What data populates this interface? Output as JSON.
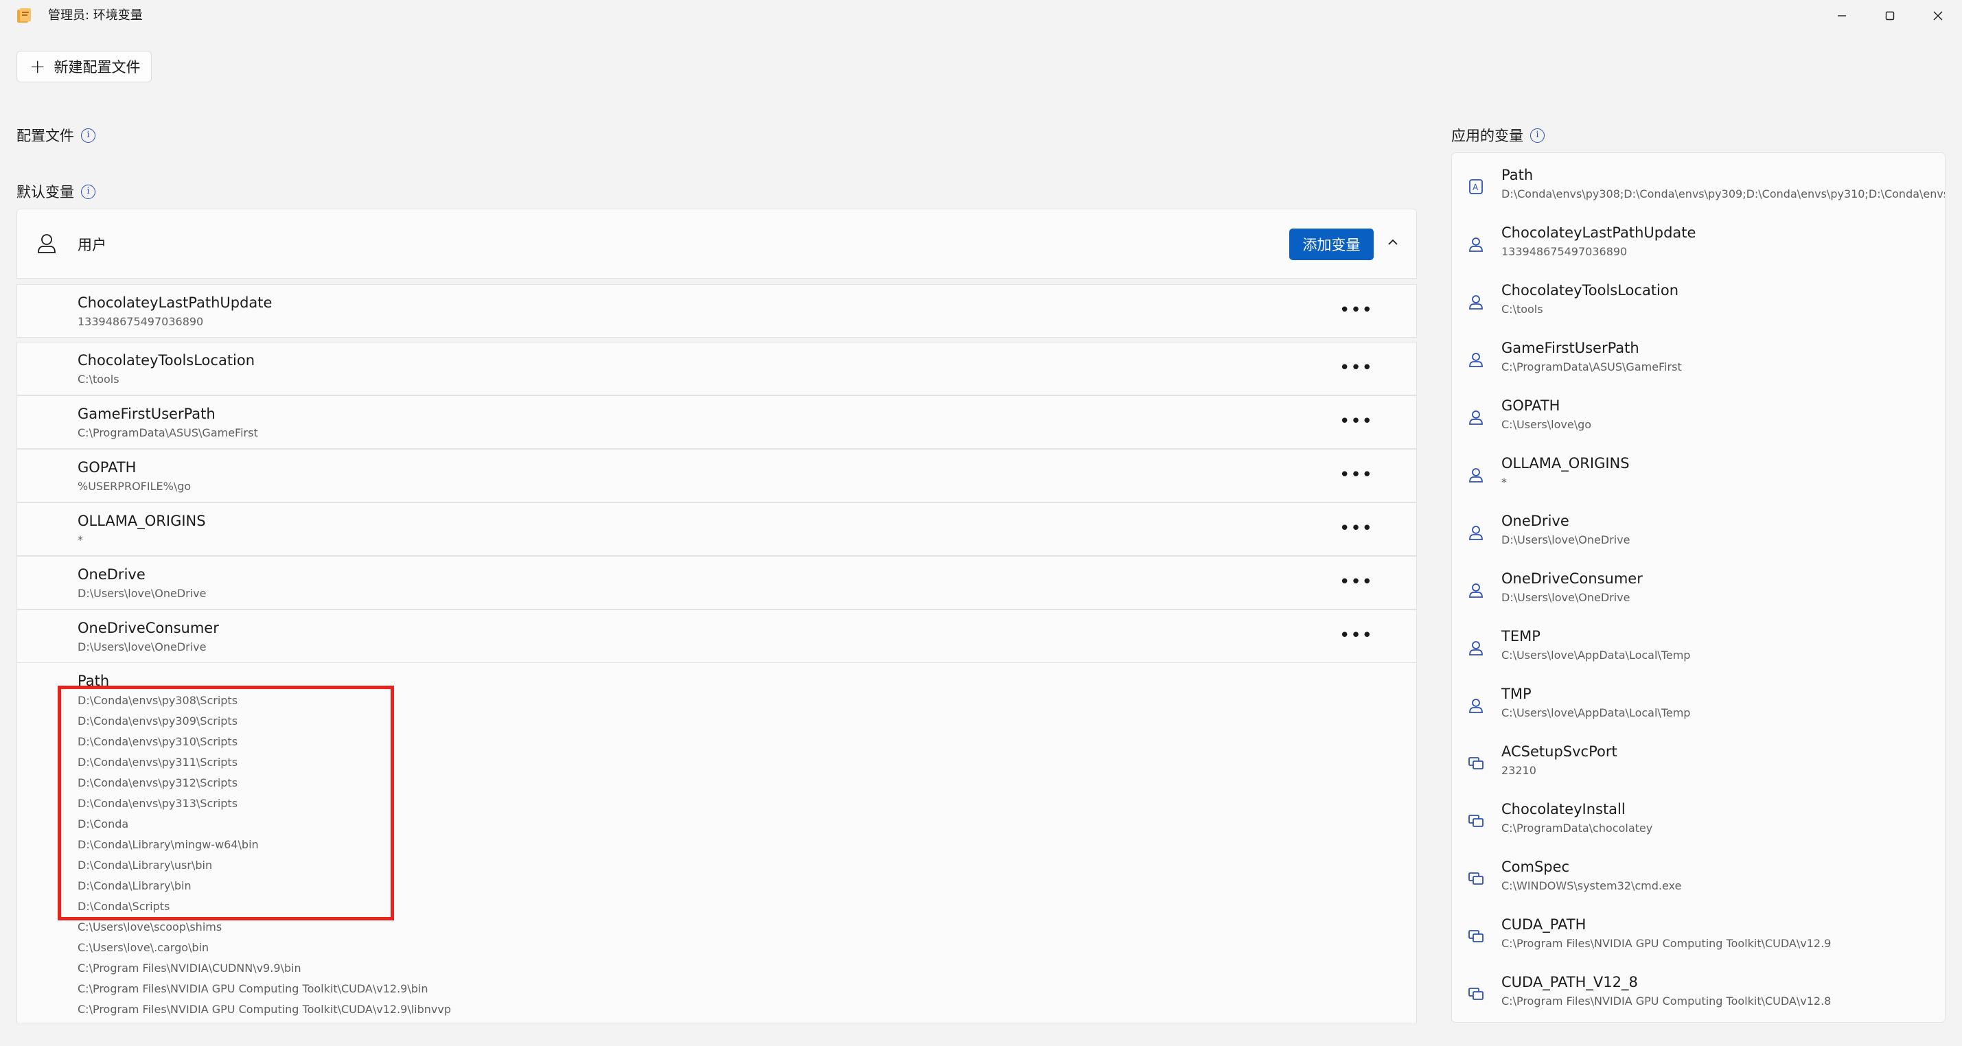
{
  "window": {
    "title": "管理员: 环境变量"
  },
  "toolbar": {
    "new_profile_label": "新建配置文件"
  },
  "sections": {
    "profiles_label": "配置文件",
    "default_vars_label": "默认变量",
    "applied_label": "应用的变量"
  },
  "user_group": {
    "label": "用户",
    "add_button_label": "添加变量"
  },
  "user_variables": [
    {
      "name": "ChocolateyLastPathUpdate",
      "value": "133948675497036890"
    },
    {
      "name": "ChocolateyToolsLocation",
      "value": "C:\\tools"
    },
    {
      "name": "GameFirstUserPath",
      "value": "C:\\ProgramData\\ASUS\\GameFirst"
    },
    {
      "name": "GOPATH",
      "value": "%USERPROFILE%\\go"
    },
    {
      "name": "OLLAMA_ORIGINS",
      "value": "*"
    },
    {
      "name": "OneDrive",
      "value": "D:\\Users\\love\\OneDrive"
    },
    {
      "name": "OneDriveConsumer",
      "value": "D:\\Users\\love\\OneDrive"
    }
  ],
  "path_variable": {
    "name": "Path",
    "values": [
      "D:\\Conda\\envs\\py308\\Scripts",
      "D:\\Conda\\envs\\py309\\Scripts",
      "D:\\Conda\\envs\\py310\\Scripts",
      "D:\\Conda\\envs\\py311\\Scripts",
      "D:\\Conda\\envs\\py312\\Scripts",
      "D:\\Conda\\envs\\py313\\Scripts",
      "D:\\Conda",
      "D:\\Conda\\Library\\mingw-w64\\bin",
      "D:\\Conda\\Library\\usr\\bin",
      "D:\\Conda\\Library\\bin",
      "D:\\Conda\\Scripts",
      "C:\\Users\\love\\scoop\\shims",
      "C:\\Users\\love\\.cargo\\bin",
      "C:\\Program Files\\NVIDIA\\CUDNN\\v9.9\\bin",
      "C:\\Program Files\\NVIDIA GPU Computing Toolkit\\CUDA\\v12.9\\bin",
      "C:\\Program Files\\NVIDIA GPU Computing Toolkit\\CUDA\\v12.9\\libnvvp"
    ]
  },
  "applied_variables": [
    {
      "name": "Path",
      "value": "D:\\Conda\\envs\\py308;D:\\Conda\\envs\\py309;D:\\Conda\\envs\\py310;D:\\Conda\\envs",
      "icon": "path-icon"
    },
    {
      "name": "ChocolateyLastPathUpdate",
      "value": "133948675497036890",
      "icon": "user-icon"
    },
    {
      "name": "ChocolateyToolsLocation",
      "value": "C:\\tools",
      "icon": "user-icon"
    },
    {
      "name": "GameFirstUserPath",
      "value": "C:\\ProgramData\\ASUS\\GameFirst",
      "icon": "user-icon"
    },
    {
      "name": "GOPATH",
      "value": "C:\\Users\\love\\go",
      "icon": "user-icon"
    },
    {
      "name": "OLLAMA_ORIGINS",
      "value": "*",
      "icon": "user-icon"
    },
    {
      "name": "OneDrive",
      "value": "D:\\Users\\love\\OneDrive",
      "icon": "user-icon"
    },
    {
      "name": "OneDriveConsumer",
      "value": "D:\\Users\\love\\OneDrive",
      "icon": "user-icon"
    },
    {
      "name": "TEMP",
      "value": "C:\\Users\\love\\AppData\\Local\\Temp",
      "icon": "user-icon"
    },
    {
      "name": "TMP",
      "value": "C:\\Users\\love\\AppData\\Local\\Temp",
      "icon": "user-icon"
    },
    {
      "name": "ACSetupSvcPort",
      "value": "23210",
      "icon": "system-icon"
    },
    {
      "name": "ChocolateyInstall",
      "value": "C:\\ProgramData\\chocolatey",
      "icon": "system-icon"
    },
    {
      "name": "ComSpec",
      "value": "C:\\WINDOWS\\system32\\cmd.exe",
      "icon": "system-icon"
    },
    {
      "name": "CUDA_PATH",
      "value": "C:\\Program Files\\NVIDIA GPU Computing Toolkit\\CUDA\\v12.9",
      "icon": "system-icon"
    },
    {
      "name": "CUDA_PATH_V12_8",
      "value": "C:\\Program Files\\NVIDIA GPU Computing Toolkit\\CUDA\\v12.8",
      "icon": "system-icon"
    }
  ],
  "colors": {
    "accent": "#0a5fc2",
    "highlight": "#e8231c",
    "info": "#2c4fb8"
  }
}
